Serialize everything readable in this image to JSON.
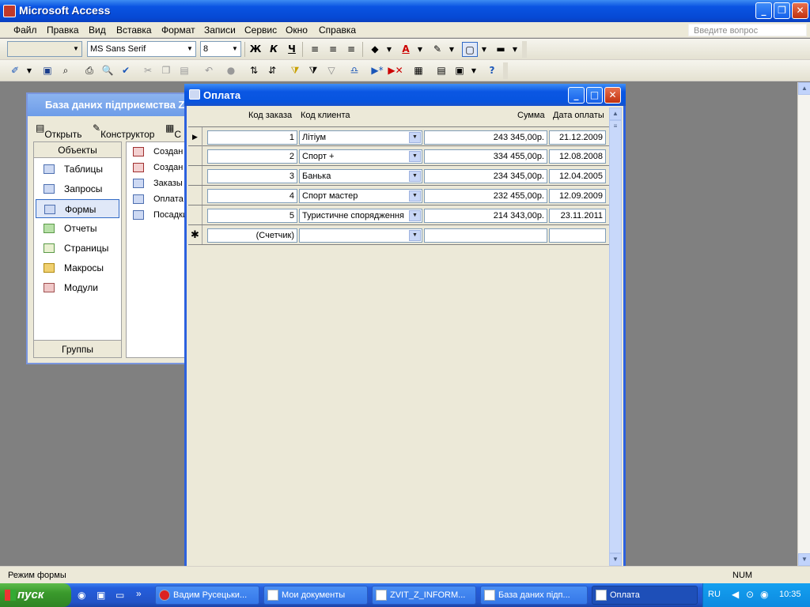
{
  "app": {
    "title": "Microsoft Access"
  },
  "menu": {
    "items": [
      "Файл",
      "Правка",
      "Вид",
      "Вставка",
      "Формат",
      "Записи",
      "Сервис",
      "Окно",
      "Справка"
    ],
    "ask_placeholder": "Введите вопрос"
  },
  "toolbar": {
    "font_name": "MS Sans Serif",
    "font_size": "8",
    "bold": "Ж",
    "italic": "К",
    "underline": "Ч"
  },
  "db_window": {
    "title": "База даних підприємства Z...",
    "open_label": "Открыть",
    "designer_label": "Конструктор",
    "create_label": "С",
    "objects_header": "Объекты",
    "objects": [
      "Таблицы",
      "Запросы",
      "Формы",
      "Отчеты",
      "Страницы",
      "Макросы",
      "Модули"
    ],
    "selected_object": "Формы",
    "groups_label": "Группы",
    "list": [
      "Создан",
      "Создан",
      "Заказы",
      "Оплата",
      "Посадки"
    ]
  },
  "form": {
    "title": "Оплата",
    "headers": {
      "order_code": "Код заказа",
      "client_code": "Код клиента",
      "sum": "Сумма",
      "date": "Дата оплаты"
    },
    "rows": [
      {
        "order_code": "1",
        "client_code": "Літіум",
        "sum": "243 345,00р.",
        "date": "21.12.2009"
      },
      {
        "order_code": "2",
        "client_code": "Спорт +",
        "sum": "334 455,00р.",
        "date": "12.08.2008"
      },
      {
        "order_code": "3",
        "client_code": "Банька",
        "sum": "234 345,00р.",
        "date": "12.04.2005"
      },
      {
        "order_code": "4",
        "client_code": "Спорт мастер",
        "sum": "232 455,00р.",
        "date": "12.09.2009"
      },
      {
        "order_code": "5",
        "client_code": "Туристичне спорядження",
        "sum": "214 343,00р.",
        "date": "23.11.2011"
      }
    ],
    "new_row_placeholder": "(Счетчик)"
  },
  "status": {
    "mode": "Режим формы",
    "num": "NUM"
  },
  "taskbar": {
    "start": "пуск",
    "tasks": [
      "Вадим Русецьки...",
      "Мои документы",
      "ZVIT_Z_INFORM...",
      "База даних підп...",
      "Оплата"
    ],
    "lang": "RU",
    "clock": "10:35"
  }
}
